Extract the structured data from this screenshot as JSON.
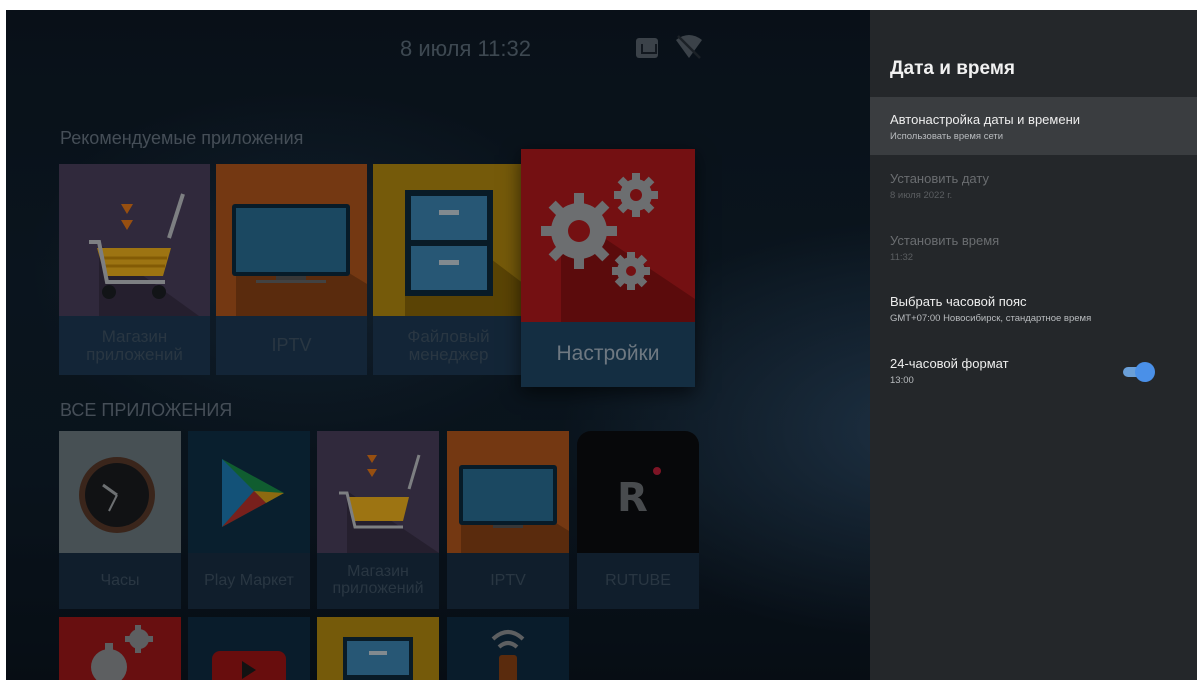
{
  "status_bar": {
    "date_time": "8 июля 11:32",
    "ethernet_icon": "ethernet-icon",
    "wifi_icon": "wifi-off-icon"
  },
  "launcher": {
    "recommended_title": "Рекомендуемые приложения",
    "recommended": [
      {
        "label": "Магазин приложений",
        "icon": "shopping-cart-icon",
        "color": "#5a4a6e"
      },
      {
        "label": "IPTV",
        "icon": "tv-icon",
        "color": "#c4601e"
      },
      {
        "label": "Файловый менеджер",
        "icon": "file-cabinet-icon",
        "color": "#c89a10"
      },
      {
        "label": "Настройки",
        "icon": "gears-icon",
        "color": "#b0191c"
      }
    ],
    "all_apps_title": "ВСЕ ПРИЛОЖЕНИЯ",
    "all_apps": [
      {
        "label": "Часы",
        "icon": "clock-icon",
        "color": "#7a8a90"
      },
      {
        "label": "Play Маркет",
        "icon": "play-store-icon",
        "color": "#0f3550"
      },
      {
        "label": "Магазин приложений",
        "icon": "shopping-cart-icon",
        "color": "#5a4a6e"
      },
      {
        "label": "IPTV",
        "icon": "tv-icon",
        "color": "#c4601e"
      },
      {
        "label": "RUTUBE",
        "icon": "rutube-icon",
        "color": "#0c0d10"
      }
    ],
    "bottom_row_icons": [
      "gears-icon",
      "youtube-icon",
      "file-cabinet-icon",
      "remote-icon"
    ]
  },
  "panel": {
    "title": "Дата и время",
    "rows": [
      {
        "title": "Автонастройка даты и времени",
        "subtitle": "Использовать время сети"
      },
      {
        "title": "Установить дату",
        "subtitle": "8 июля 2022 г."
      },
      {
        "title": "Установить время",
        "subtitle": "11:32"
      },
      {
        "title": "Выбрать часовой пояс",
        "subtitle": "GMT+07:00 Новосибирск, стандартное время"
      },
      {
        "title": "24-часовой формат",
        "subtitle": "13:00"
      }
    ],
    "toggle_24h": {
      "state": "on",
      "color": "#4a90e8"
    }
  }
}
